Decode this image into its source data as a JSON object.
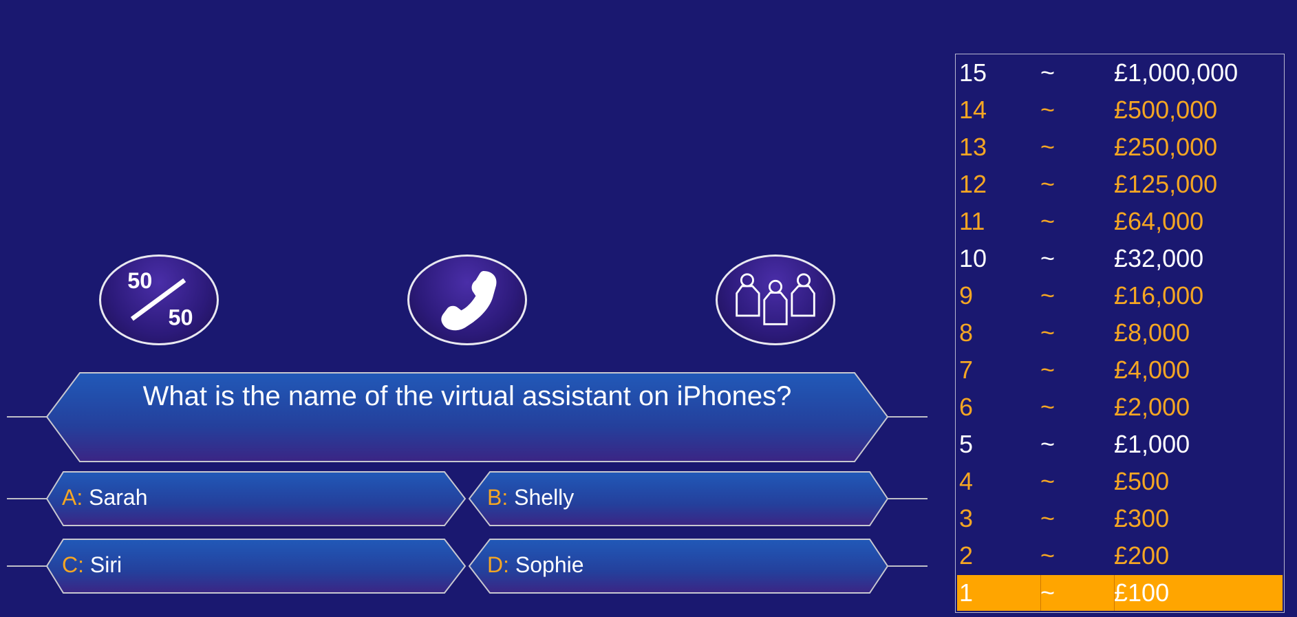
{
  "lifelines": [
    {
      "name": "fifty-fifty",
      "label_top": "50",
      "label_bottom": "50",
      "icon": "fifty-fifty-icon"
    },
    {
      "name": "phone-a-friend",
      "icon": "phone-icon"
    },
    {
      "name": "ask-the-audience",
      "icon": "audience-icon"
    }
  ],
  "question": {
    "text": "What is the name of the virtual assistant on iPhones?"
  },
  "answers": {
    "a": {
      "letter": "A:",
      "text": "Sarah"
    },
    "b": {
      "letter": "B:",
      "text": "Shelly"
    },
    "c": {
      "letter": "C:",
      "text": "Siri"
    },
    "d": {
      "letter": "D:",
      "text": "Sophie"
    }
  },
  "ladder": [
    {
      "level": "15",
      "sep": "~",
      "amount": "£1,000,000",
      "milestone": true
    },
    {
      "level": "14",
      "sep": "~",
      "amount": "£500,000",
      "milestone": false
    },
    {
      "level": "13",
      "sep": "~",
      "amount": "£250,000",
      "milestone": false
    },
    {
      "level": "12",
      "sep": "~",
      "amount": "£125,000",
      "milestone": false
    },
    {
      "level": "11",
      "sep": "~",
      "amount": "£64,000",
      "milestone": false
    },
    {
      "level": "10",
      "sep": "~",
      "amount": "£32,000",
      "milestone": true
    },
    {
      "level": "9",
      "sep": "~",
      "amount": "£16,000",
      "milestone": false
    },
    {
      "level": "8",
      "sep": "~",
      "amount": "£8,000",
      "milestone": false
    },
    {
      "level": "7",
      "sep": "~",
      "amount": "£4,000",
      "milestone": false
    },
    {
      "level": "6",
      "sep": "~",
      "amount": "£2,000",
      "milestone": false
    },
    {
      "level": "5",
      "sep": "~",
      "amount": "£1,000",
      "milestone": true
    },
    {
      "level": "4",
      "sep": "~",
      "amount": "£500",
      "milestone": false
    },
    {
      "level": "3",
      "sep": "~",
      "amount": "£300",
      "milestone": false
    },
    {
      "level": "2",
      "sep": "~",
      "amount": "£200",
      "milestone": false
    },
    {
      "level": "1",
      "sep": "~",
      "amount": "£100",
      "milestone": false,
      "current": true
    }
  ],
  "colors": {
    "background": "#1a1870",
    "accent": "#f5a623",
    "current_level": "#ffa500",
    "text": "#ffffff"
  }
}
